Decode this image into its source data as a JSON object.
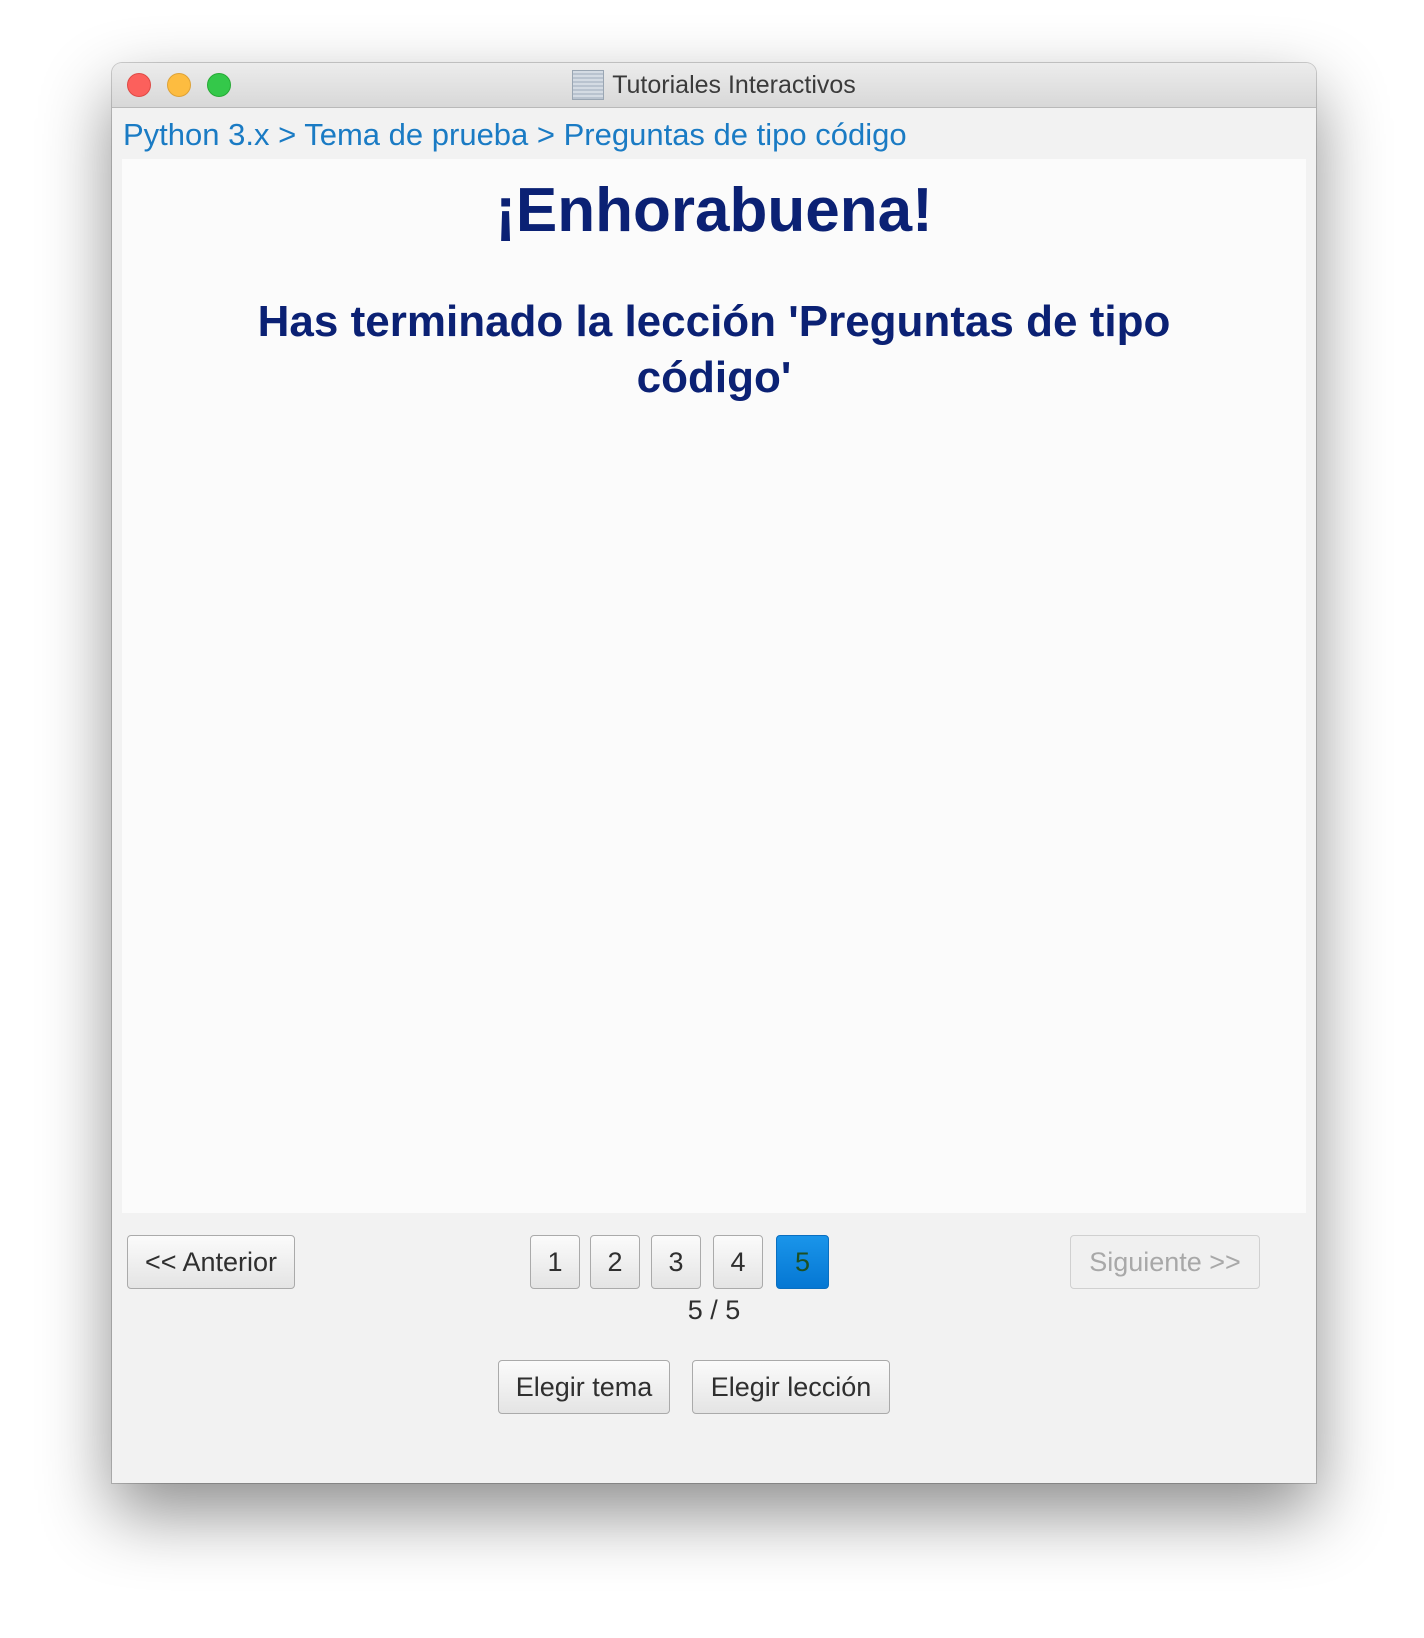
{
  "window": {
    "title": "Tutoriales Interactivos",
    "app_icon": "tutorial-app-icon"
  },
  "breadcrumb": "Python 3.x > Tema de prueba > Preguntas de tipo código",
  "content": {
    "heading": "¡Enhorabuena!",
    "message": "Has terminado la lección 'Preguntas de tipo código'"
  },
  "navigation": {
    "prev_label": "<< Anterior",
    "next_label": "Siguiente >>",
    "next_enabled": false,
    "pages": [
      "1",
      "2",
      "3",
      "4",
      "5"
    ],
    "current_page": "5",
    "page_counter": "5 / 5",
    "choose_topic_label": "Elegir tema",
    "choose_lesson_label": "Elegir lección"
  },
  "colors": {
    "link": "#1a7bc4",
    "heading": "#0b2174",
    "active_page": "#0a84e0"
  }
}
